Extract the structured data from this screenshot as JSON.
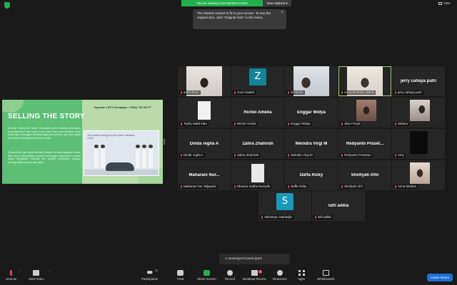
{
  "top": {
    "banner": "You are viewing Anna Maritsa's screen",
    "view_options": "View Options ▾",
    "view": "View"
  },
  "tooltip": {
    "text": "The shared content is fit to your screen. To see the original size, click “Original Size” in the menu.",
    "close": "×"
  },
  "slide": {
    "title": "SELLING THE STORY",
    "p1": "Konsep “selling the story” merupakan jenis strategi pemasaran yang dilakukan oleh brand untuk lebih fokus menceritakan kisah yang ingin pelanggan tentang bagaimana produk atau jasa dapat membantu kebahagiaan hidup mereka.",
    "p2": "Storyselling juga dapat berhasil dengan mengembangkan narasi fiktif yang menunjukkan kepada pelanggan bagaimana mereka dapat mengalami manfaat dari sebuah pembelian maupun menggunakan produk atau jasa.",
    "campaign": "Hyundai x BTS Campaign : IONIQ “IM ON IT”",
    "caption": "The positive energy for your future. Because of you."
  },
  "participants": [
    {
      "name": "ardini feruz",
      "kind": "video",
      "muted": true
    },
    {
      "name": "zoom baa04",
      "kind": "avatar",
      "initial": "Z",
      "muted": true
    },
    {
      "name": "M Khoiru",
      "kind": "video",
      "muted": true
    },
    {
      "name": "Ananda Rezky Nabila",
      "kind": "video",
      "muted": true,
      "active": true
    },
    {
      "name": "jerry cahaya putri",
      "display": "jerry cahaya putri",
      "kind": "name",
      "muted": true
    },
    {
      "name": "Taufiq Nabil Irfan",
      "kind": "image",
      "muted": true
    },
    {
      "name": "Richel Amelia",
      "display": "Richel Amelia",
      "kind": "name",
      "muted": true
    },
    {
      "name": "Enggar Widya",
      "display": "Enggar Widya",
      "kind": "name",
      "muted": true
    },
    {
      "name": "Jilan Feryal",
      "kind": "image",
      "muted": true
    },
    {
      "name": "Safana",
      "kind": "image",
      "muted": true
    },
    {
      "name": "Dinda regita A",
      "display": "Dinda regita A",
      "kind": "name",
      "muted": true
    },
    {
      "name": "Zahra Zhahirah",
      "display": "Zahra Zhahirah",
      "kind": "name",
      "muted": true
    },
    {
      "name": "Meindra Virgi M",
      "display": "Meindra Virgi M",
      "kind": "name",
      "muted": true
    },
    {
      "name": "Redyanto Prasetyo",
      "display": "Redyanto  Praset...",
      "kind": "name",
      "muted": true
    },
    {
      "name": "Amy",
      "kind": "image",
      "muted": true
    },
    {
      "name": "Maharani Nur Wijayanti",
      "display": "Maharani  Nur...",
      "kind": "name",
      "muted": true
    },
    {
      "name": "Dheana Vedha Nursyifa",
      "kind": "image",
      "muted": true
    },
    {
      "name": "Daffa Rizky",
      "display": "Daffa Rizky",
      "kind": "name",
      "muted": true
    },
    {
      "name": "Shofiyah Afni",
      "display": "Shofiyah Afni",
      "kind": "name",
      "muted": true
    },
    {
      "name": "Anna Maritsa",
      "kind": "image",
      "muted": true
    },
    {
      "name": "Abimanyu Satriadjie",
      "kind": "avatar",
      "initial": "S",
      "muted": true
    },
    {
      "name": "lutfi aditia",
      "display": "lutfi aditia",
      "kind": "name",
      "muted": true
    }
  ],
  "unassigned": "1 unassigned participant",
  "toolbar": {
    "unmute": "Unmute",
    "start_video": "Start Video",
    "participants": "Participants",
    "participants_count": "22",
    "chat": "Chat",
    "share_screen": "Share Screen",
    "record": "Record",
    "breakout_rooms": "Breakout Rooms",
    "breakout_badge": "1",
    "reactions": "Reactions",
    "apps": "Apps",
    "whiteboards": "Whiteboards",
    "leave": "Leave Room"
  },
  "colors": {
    "accent": "#23b14d",
    "active_speaker": "#9fd05a",
    "leave": "#1f6fd6",
    "muted": "#e0474c"
  }
}
